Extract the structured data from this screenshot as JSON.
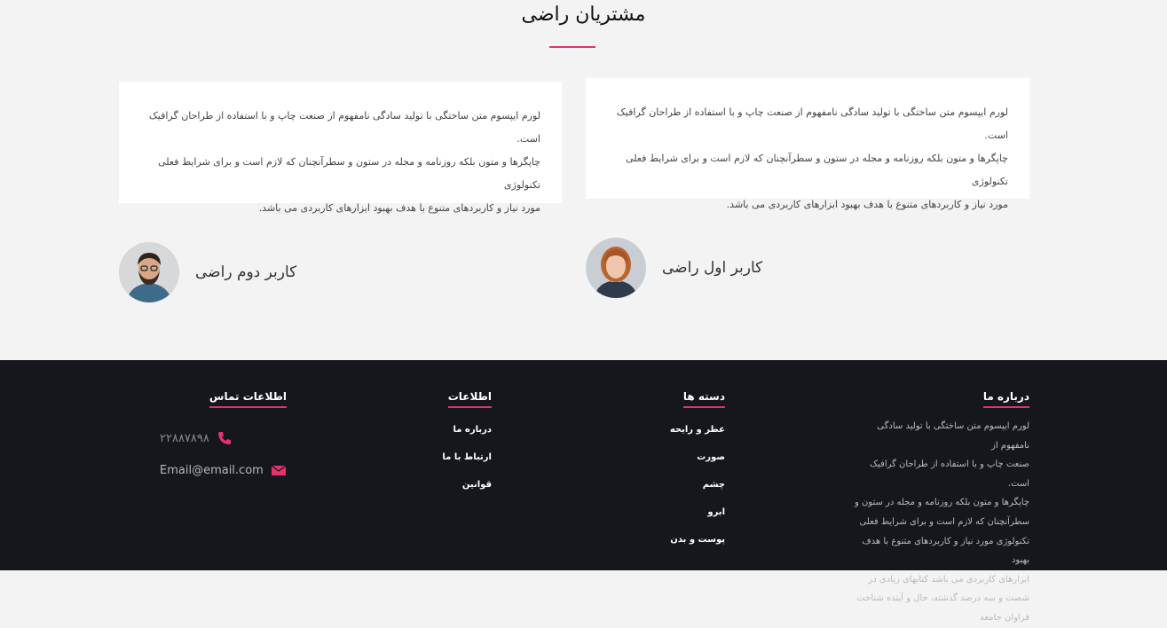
{
  "testimonials": {
    "title": "مشتریان راضی",
    "items": [
      {
        "lines": [
          "لورم ایپسوم متن ساختگی با تولید سادگی نامفهوم از صنعت چاپ و با استفاده از طراحان گرافیک است.",
          "چاپگرها و متون بلکه روزنامه و مجله در ستون و سطرآنچنان که لازم است و برای شرایط فعلی تکنولوژی",
          "مورد نیاز و کاربردهای متنوع با هدف بهبود ابزارهای کاربردی می باشد."
        ],
        "name": "کاربر اول راضی"
      },
      {
        "lines": [
          "لورم ایپسوم متن ساختگی با تولید سادگی نامفهوم از صنعت چاپ و با استفاده از طراحان گرافیک است.",
          "چاپگرها و متون بلکه روزنامه و مجله در ستون و سطرآنچنان که لازم است و برای شرایط فعلی تکنولوژی",
          "مورد نیاز و کاربردهای متنوع با هدف بهبود ابزارهای کاربردی می باشد."
        ],
        "name": "کاربر دوم راضی"
      }
    ]
  },
  "footer": {
    "about": {
      "title": "درباره ما",
      "lines": [
        "لورم ایپسوم متن ساختگی با تولید سادگی نامفهوم از",
        "صنعت چاپ و با استفاده از طراحان گرافیک است.",
        "چاپگرها و متون بلکه روزنامه و مجله در ستون و",
        "سطرآنچنان که لازم است و برای شرایط فعلی",
        "تکنولوژی مورد نیاز و کاربردهای متنوع با هدف بهبود",
        "ابزارهای کاربردی می باشد کتابهای زیادی در",
        "شصت و سه درصد گذشته، حال و آینده شناخت",
        "فراوان جامعه"
      ]
    },
    "categories": {
      "title": "دسته ها",
      "items": [
        "عطر و رایحه",
        "صورت",
        "چشم",
        "ابرو",
        "پوست و بدن"
      ]
    },
    "info": {
      "title": "اطلاعات",
      "items": [
        "درباره ما",
        "ارتباط با ما",
        "قوانین"
      ]
    },
    "contact": {
      "title": "اطلاعات تماس",
      "phone": "۲۲۸۸۷۸۹۸",
      "email": "Email@email.com"
    },
    "accent_color": "#e5326e"
  }
}
